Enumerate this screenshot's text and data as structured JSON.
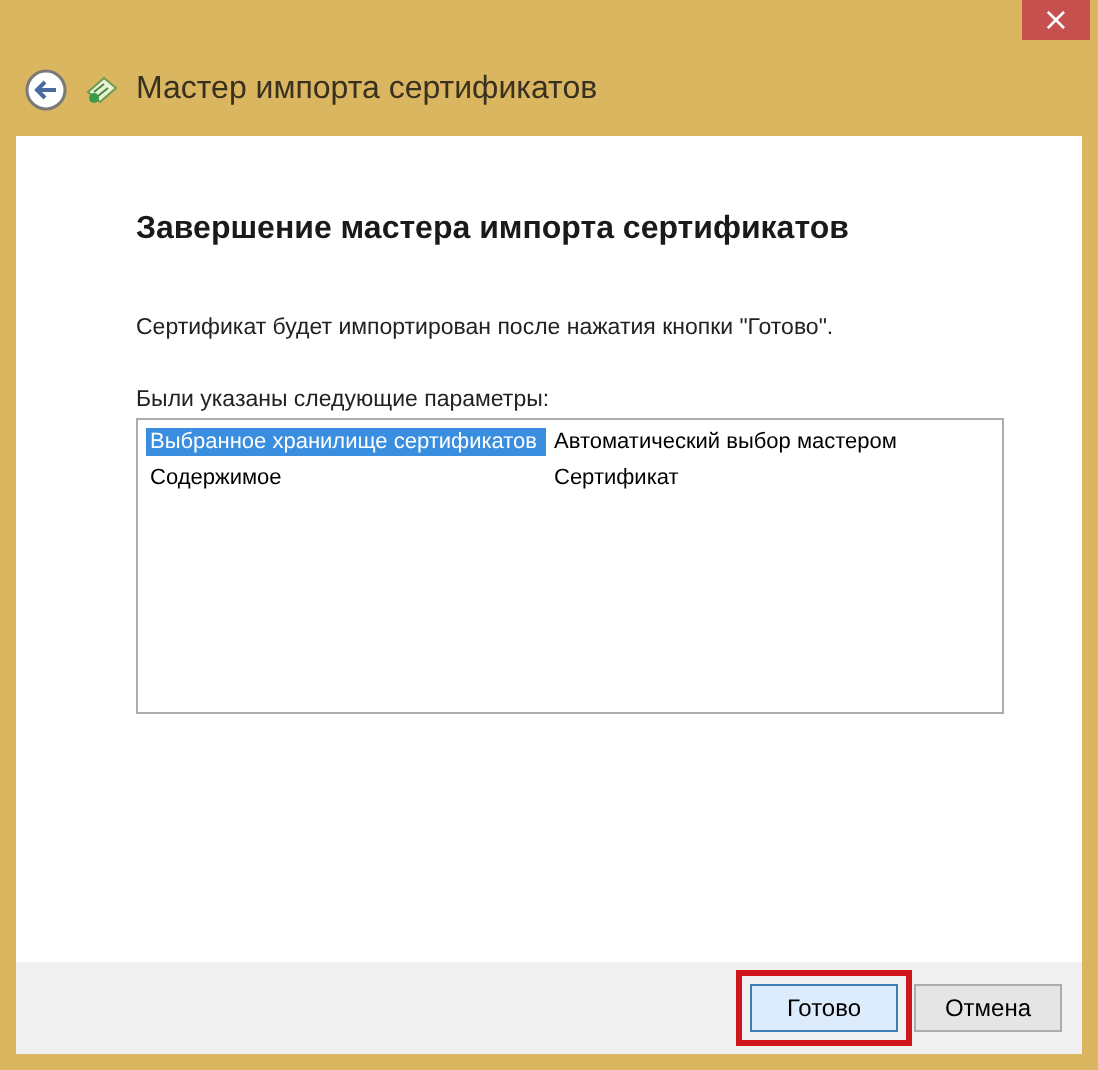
{
  "window": {
    "title": "Мастер импорта сертификатов",
    "close": "×"
  },
  "page": {
    "heading": "Завершение мастера импорта сертификатов",
    "message": "Сертификат будет импортирован после нажатия кнопки \"Готово\".",
    "list_label": "Были указаны следующие параметры:"
  },
  "settings": [
    {
      "name": "Выбранное хранилище сертификатов",
      "value": "Автоматический выбор мастером",
      "selected": true
    },
    {
      "name": "Содержимое",
      "value": "Сертификат",
      "selected": false
    }
  ],
  "buttons": [
    {
      "label": "Готово",
      "highlighted": true
    },
    {
      "label": "Отмена",
      "highlighted": false
    }
  ]
}
